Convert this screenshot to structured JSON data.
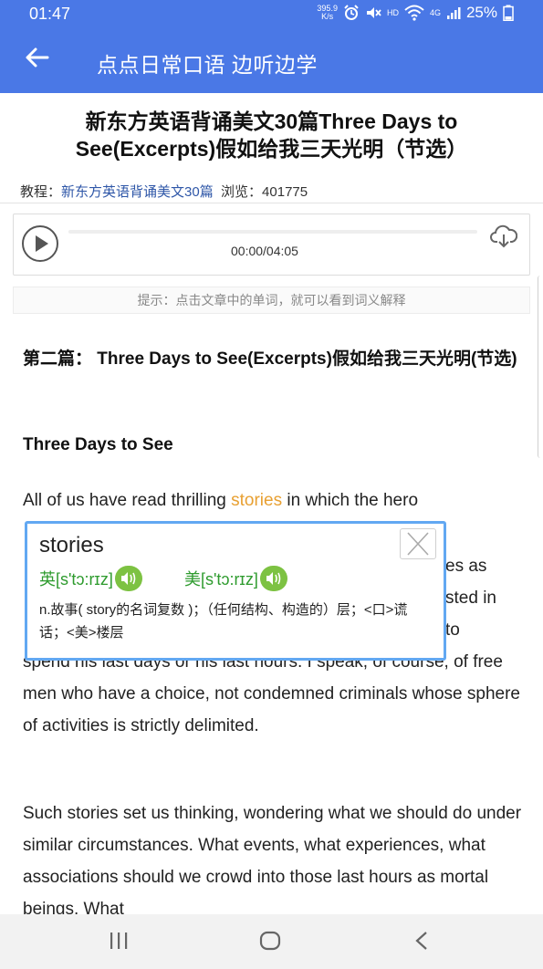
{
  "status": {
    "time": "01:47",
    "speed_top": "395.9",
    "speed_bottom": "K/s",
    "hd": "HD",
    "net": "4G",
    "battery": "25%"
  },
  "appbar": {
    "title": "点点日常口语 边听边学"
  },
  "article": {
    "title": "新东方英语背诵美文30篇Three Days to See(Excerpts)假如给我三天光明（节选）",
    "meta_prefix": "教程：",
    "meta_link": "新东方英语背诵美文30篇",
    "meta_views": "浏览：401775"
  },
  "player": {
    "time": "00:00/04:05"
  },
  "hint": "提示：点击文章中的单词，就可以看到词义解释",
  "content": {
    "section_heading": "第二篇： Three Days to See(Excerpts)假如给我三天光明(节选)",
    "sub_heading": "Three Days to See",
    "p1_before": "All of us have read thrilling ",
    "p1_word": "stories",
    "p1_after": " in which the hero",
    "p1_frag2": "es as",
    "p1_frag3": "sted in",
    "p1_frag4": "to",
    "p1_rest": "spend his last days or his last hours. I speak, of course, of free men who have a choice, not condemned criminals whose sphere of activities is strictly delimited.",
    "p2": "Such stories set us thinking, wondering what we should do under similar circumstances. What events, what experiences, what associations should we crowd into those last hours as mortal beings. What"
  },
  "popup": {
    "word": "stories",
    "uk": "英[s'tɔ:rɪz]",
    "us": "美[s'tɔ:rɪz]",
    "definition": "n.故事( story的名词复数 )；（任何结构、构造的）层；<口>谎话；<美>楼层"
  },
  "colors": {
    "primary": "#4a78e6",
    "highlight": "#e8a032",
    "phonetic": "#2e9b2e",
    "popup_border": "#62a8f2"
  }
}
